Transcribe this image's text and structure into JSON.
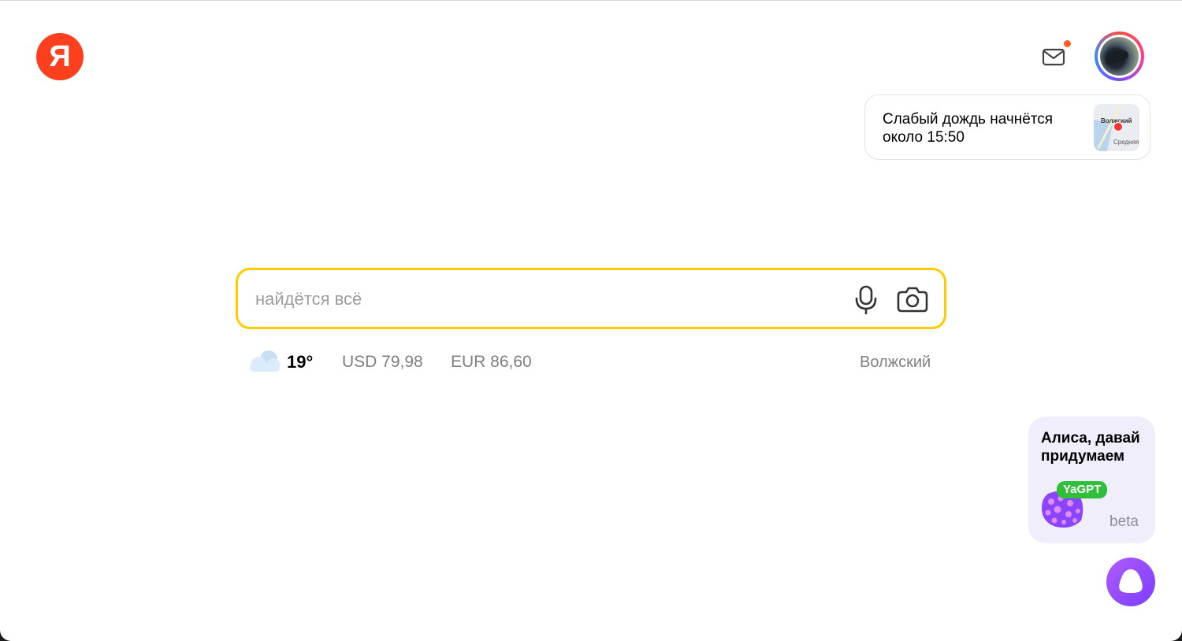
{
  "header": {
    "logo_letter": "Я",
    "mail_icon": "mail-icon",
    "has_notification": true
  },
  "rain_card": {
    "text": "Слабый дождь начнётся около 15:50",
    "map_city_label": "Волжский",
    "map_river_label": "Средняя"
  },
  "search": {
    "placeholder": "найдётся всё",
    "value": "",
    "mic_icon": "microphone-icon",
    "camera_icon": "camera-icon"
  },
  "info_row": {
    "weather_icon": "cloud-icon",
    "temperature": "19°",
    "usd": "USD 79,98",
    "eur": "EUR 86,60",
    "region": "Волжский"
  },
  "alice_promo": {
    "text": "Алиса, давай придумаем",
    "badge": "YaGPT",
    "beta_label": "beta"
  },
  "colors": {
    "brand_red": "#fc3f1d",
    "search_border": "#ffcc00",
    "alice_purple": "#8a45ff",
    "yagpt_green": "#2fbf3a",
    "notification_dot": "#ff5c26"
  }
}
